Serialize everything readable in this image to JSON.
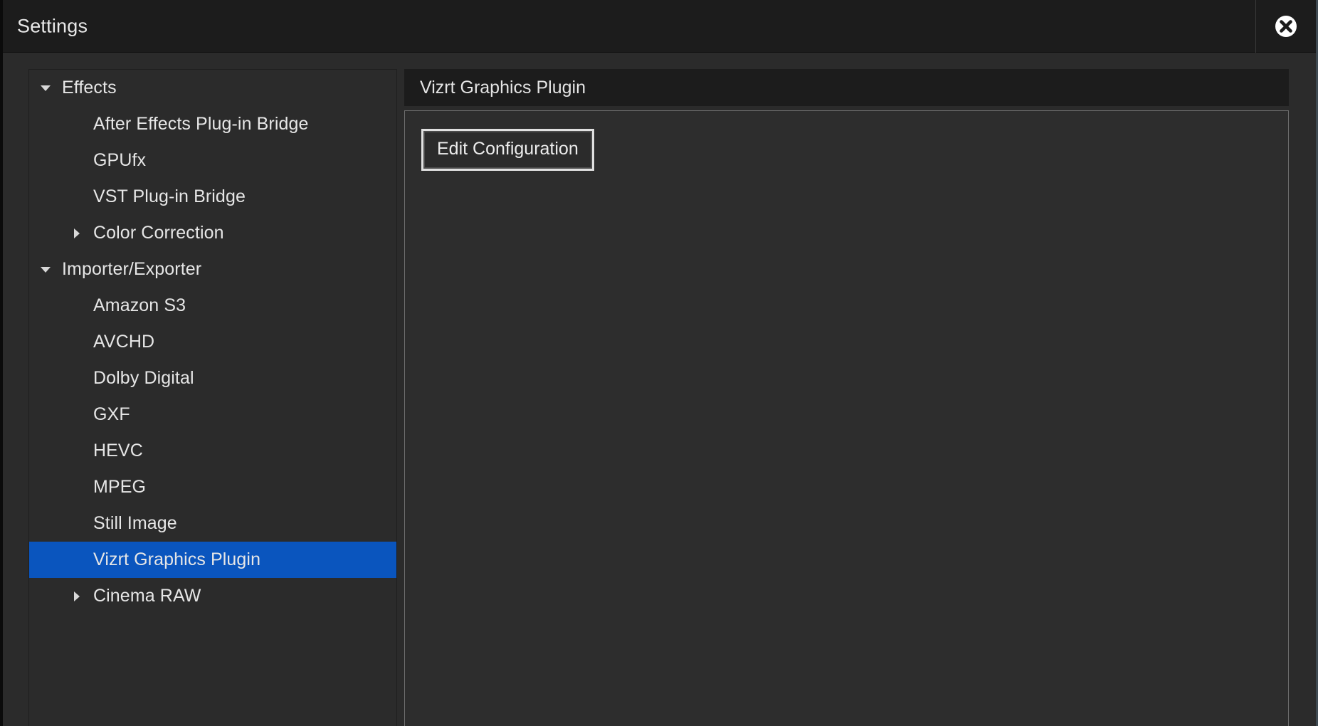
{
  "window": {
    "title": "Settings",
    "close_icon": "close-circle-icon",
    "accent_color": "#0a55be",
    "titlebar_bg": "#1c1c1c",
    "body_bg": "#2b2b2b"
  },
  "sidebar": {
    "items": [
      {
        "label": "Effects",
        "level": 0,
        "arrow": "triangle-down",
        "selected": false
      },
      {
        "label": "After Effects Plug-in Bridge",
        "level": 1,
        "arrow": "none",
        "selected": false
      },
      {
        "label": "GPUfx",
        "level": 1,
        "arrow": "none",
        "selected": false
      },
      {
        "label": "VST Plug-in Bridge",
        "level": 1,
        "arrow": "none",
        "selected": false
      },
      {
        "label": "Color Correction",
        "level": 1,
        "arrow": "triangle-right",
        "selected": false
      },
      {
        "label": "Importer/Exporter",
        "level": 0,
        "arrow": "triangle-down",
        "selected": false
      },
      {
        "label": "Amazon S3",
        "level": 1,
        "arrow": "none",
        "selected": false
      },
      {
        "label": "AVCHD",
        "level": 1,
        "arrow": "none",
        "selected": false
      },
      {
        "label": "Dolby Digital",
        "level": 1,
        "arrow": "none",
        "selected": false
      },
      {
        "label": "GXF",
        "level": 1,
        "arrow": "none",
        "selected": false
      },
      {
        "label": "HEVC",
        "level": 1,
        "arrow": "none",
        "selected": false
      },
      {
        "label": "MPEG",
        "level": 1,
        "arrow": "none",
        "selected": false
      },
      {
        "label": "Still Image",
        "level": 1,
        "arrow": "none",
        "selected": false
      },
      {
        "label": "Vizrt Graphics Plugin",
        "level": 1,
        "arrow": "none",
        "selected": true
      },
      {
        "label": "Cinema RAW",
        "level": 1,
        "arrow": "triangle-right",
        "selected": false
      }
    ]
  },
  "panel": {
    "header_title": "Vizrt Graphics Plugin",
    "edit_configuration_label": "Edit Configuration"
  }
}
